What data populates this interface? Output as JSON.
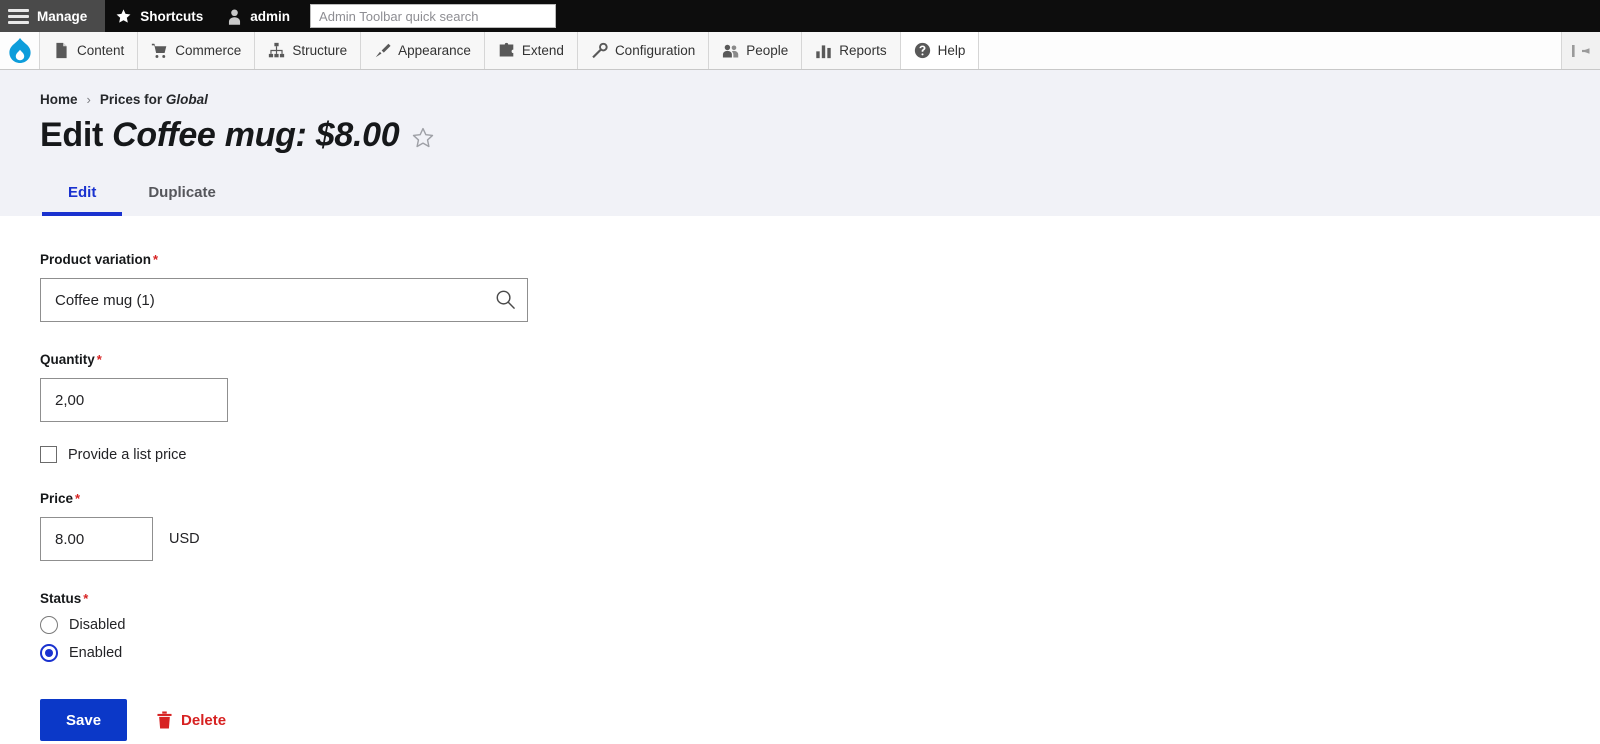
{
  "admin_bar": {
    "manage_label": "Manage",
    "shortcuts_label": "Shortcuts",
    "account_label": "admin",
    "search_placeholder": "Admin Toolbar quick search",
    "search_value": ""
  },
  "menu_bar": {
    "logo_name": "drupal-logo",
    "items": [
      {
        "label": "Content",
        "icon": "document-icon"
      },
      {
        "label": "Commerce",
        "icon": "shopping-cart-icon"
      },
      {
        "label": "Structure",
        "icon": "sitemap-icon"
      },
      {
        "label": "Appearance",
        "icon": "paintbrush-icon"
      },
      {
        "label": "Extend",
        "icon": "puzzle-piece-icon"
      },
      {
        "label": "Configuration",
        "icon": "wrench-icon"
      },
      {
        "label": "People",
        "icon": "people-icon"
      },
      {
        "label": "Reports",
        "icon": "bar-chart-icon"
      },
      {
        "label": "Help",
        "icon": "question-mark-icon"
      }
    ],
    "collapse_icon": "collapse-sidebar-icon"
  },
  "breadcrumb": {
    "home": "Home",
    "separator": "›",
    "current_prefix": "Prices for ",
    "current_emphasis": "Global"
  },
  "title": {
    "prefix": "Edit ",
    "emphasis": "Coffee mug: $8.00",
    "favorite_icon": "star-outline-icon"
  },
  "tabs": [
    {
      "label": "Edit",
      "active": true
    },
    {
      "label": "Duplicate",
      "active": false
    }
  ],
  "form": {
    "product_variation": {
      "label": "Product variation",
      "required_marker": "*",
      "value": "Coffee mug (1)",
      "placeholder": "",
      "icon": "search-icon"
    },
    "quantity": {
      "label": "Quantity",
      "required_marker": "*",
      "value": "2,00",
      "placeholder": ""
    },
    "list_price": {
      "label": "Provide a list price",
      "checked": false
    },
    "price": {
      "label": "Price",
      "required_marker": "*",
      "value": "8.00",
      "placeholder": "",
      "currency": "USD"
    },
    "status": {
      "label": "Status",
      "required_marker": "*",
      "options": [
        {
          "label": "Disabled",
          "selected": false
        },
        {
          "label": "Enabled",
          "selected": true
        }
      ]
    }
  },
  "actions": {
    "save_label": "Save",
    "delete_label": "Delete",
    "delete_icon": "trash-icon"
  },
  "colors": {
    "admin_bar_bg": "#0d0d0d",
    "manage_tab_bg": "#4a4a4a",
    "header_bg": "#f1f2f7",
    "accent_blue": "#1a32cf",
    "save_button_blue": "#0b38c8",
    "danger_red": "#d72222",
    "drupal_logo_blue": "#0d9ddb"
  }
}
